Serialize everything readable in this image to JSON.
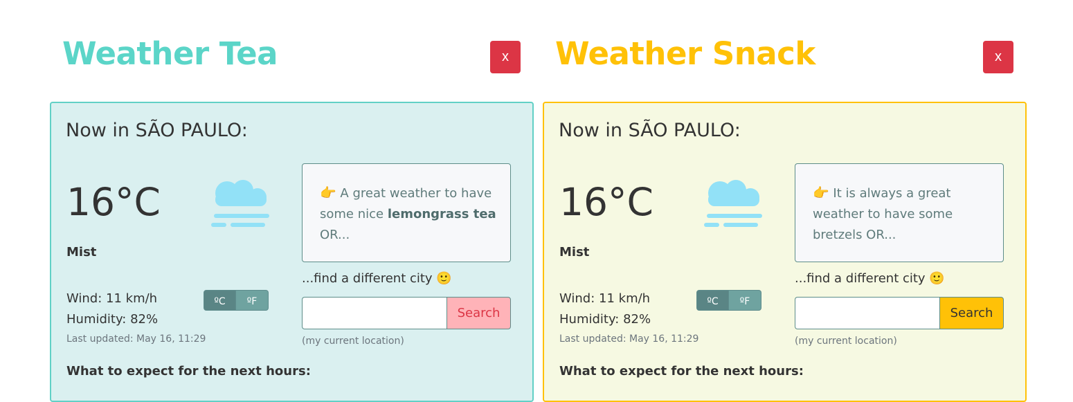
{
  "apps": [
    {
      "title": "Weather Tea",
      "close_label": "x",
      "accent": "#5bd5c8",
      "card_bg": "#daf0f0",
      "card_border": "#61d0c6",
      "heading": "Now in SÃO PAULO:",
      "temperature": "16°C",
      "weather_icon": "mist-icon",
      "condition": "Mist",
      "wind": "Wind: 11 km/h",
      "humidity": "Humidity: 82%",
      "last_updated": "Last updated: May 16, 11:29",
      "unit_c": "ºC",
      "unit_f": "ºF",
      "suggestion_prefix": "A great weather to have some nice ",
      "suggestion_bold": "lemongrass tea",
      "suggestion_suffix": " OR...",
      "find_city": "...find a different city",
      "search_placeholder": "",
      "search_label": "Search",
      "search_bg": "#ffb3b8",
      "search_text": "#dc3545",
      "current_location": "(my current location)",
      "expect_heading": "What to expect for the next hours:"
    },
    {
      "title": "Weather Snack",
      "close_label": "x",
      "accent": "#ffc107",
      "card_bg": "#f6f9e2",
      "card_border": "#ffc107",
      "heading": "Now in SÃO PAULO:",
      "temperature": "16°C",
      "weather_icon": "mist-icon",
      "condition": "Mist",
      "wind": "Wind: 11 km/h",
      "humidity": "Humidity: 82%",
      "last_updated": "Last updated: May 16, 11:29",
      "unit_c": "ºC",
      "unit_f": "ºF",
      "suggestion_prefix": "It is always a great weather to have some bretzels OR...",
      "suggestion_bold": "",
      "suggestion_suffix": "",
      "find_city": "...find a different city",
      "search_placeholder": "",
      "search_label": "Search",
      "search_bg": "#ffc107",
      "search_text": "#333333",
      "current_location": "(my current location)",
      "expect_heading": "What to expect for the next hours:"
    }
  ]
}
